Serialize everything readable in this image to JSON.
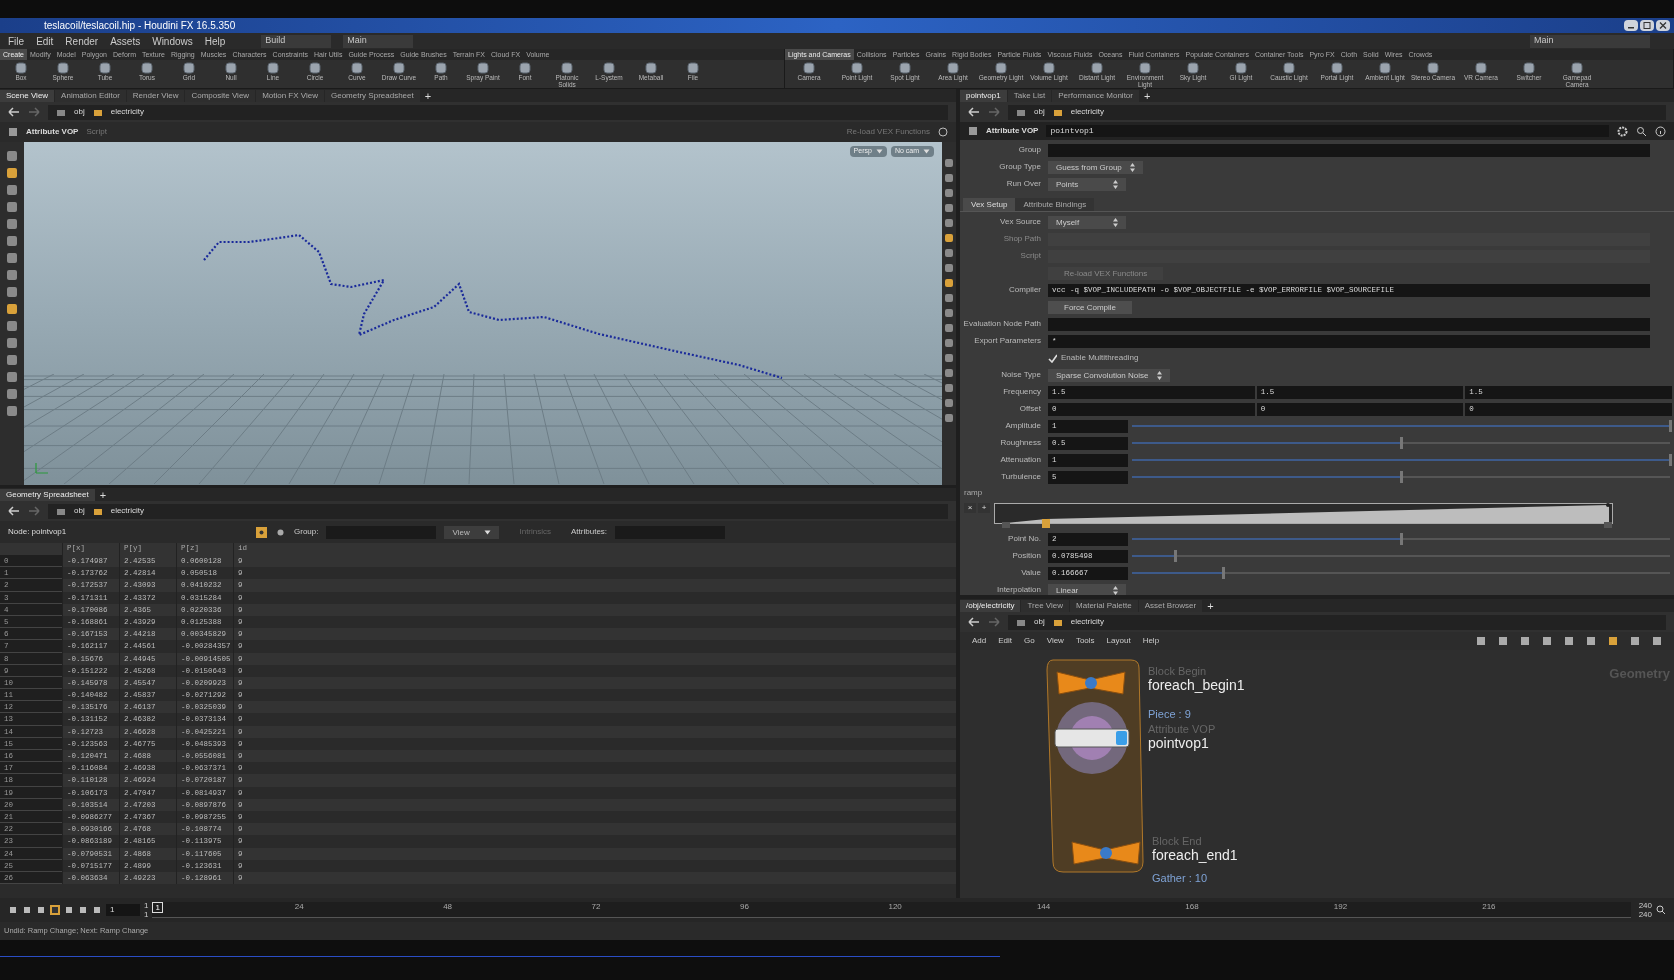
{
  "window": {
    "title": "teslacoil/teslacoil.hip - Houdini FX 16.5.350",
    "menu": [
      "File",
      "Edit",
      "Render",
      "Assets",
      "Windows",
      "Help"
    ],
    "desktop": "Build",
    "main_desktop": "Main",
    "right_desktop": "Main"
  },
  "shelf_left": {
    "tabs": [
      {
        "label": "Create",
        "selected": true
      },
      {
        "label": "Modify",
        "selected": false
      },
      {
        "label": "Model",
        "selected": false
      },
      {
        "label": "Polygon",
        "selected": false
      },
      {
        "label": "Deform",
        "selected": false
      },
      {
        "label": "Texture",
        "selected": false
      },
      {
        "label": "Rigging",
        "selected": false
      },
      {
        "label": "Muscles",
        "selected": false
      },
      {
        "label": "Characters",
        "selected": false
      },
      {
        "label": "Constraints",
        "selected": false
      },
      {
        "label": "Hair Utils",
        "selected": false
      },
      {
        "label": "Guide Process",
        "selected": false
      },
      {
        "label": "Guide Brushes",
        "selected": false
      },
      {
        "label": "Terrain FX",
        "selected": false
      },
      {
        "label": "Cloud FX",
        "selected": false
      },
      {
        "label": "Volume",
        "selected": false
      }
    ],
    "tools": [
      "Box",
      "Sphere",
      "Tube",
      "Torus",
      "Grid",
      "Null",
      "Line",
      "Circle",
      "Curve",
      "Draw Curve",
      "Path",
      "Spray Paint",
      "Font",
      "Platonic Solids",
      "L-System",
      "Metaball",
      "File"
    ]
  },
  "shelf_right": {
    "tabs": [
      {
        "label": "Lights and Cameras",
        "selected": true
      },
      {
        "label": "Collisions",
        "selected": false
      },
      {
        "label": "Particles",
        "selected": false
      },
      {
        "label": "Grains",
        "selected": false
      },
      {
        "label": "Rigid Bodies",
        "selected": false
      },
      {
        "label": "Particle Fluids",
        "selected": false
      },
      {
        "label": "Viscous Fluids",
        "selected": false
      },
      {
        "label": "Oceans",
        "selected": false
      },
      {
        "label": "Fluid Containers",
        "selected": false
      },
      {
        "label": "Populate Containers",
        "selected": false
      },
      {
        "label": "Container Tools",
        "selected": false
      },
      {
        "label": "Pyro FX",
        "selected": false
      },
      {
        "label": "Cloth",
        "selected": false
      },
      {
        "label": "Solid",
        "selected": false
      },
      {
        "label": "Wires",
        "selected": false
      },
      {
        "label": "Crowds",
        "selected": false
      }
    ],
    "tools": [
      "Camera",
      "Point Light",
      "Spot Light",
      "Area Light",
      "Geometry Light",
      "Volume Light",
      "Distant Light",
      "Environment Light",
      "Sky Light",
      "GI Light",
      "Caustic Light",
      "Portal Light",
      "Ambient Light",
      "Stereo Camera",
      "VR Camera",
      "Switcher",
      "Gamepad Camera"
    ]
  },
  "left_pane": {
    "tabs": [
      {
        "label": "Scene View",
        "selected": true
      },
      {
        "label": "Animation Editor",
        "selected": false
      },
      {
        "label": "Render View",
        "selected": false
      },
      {
        "label": "Composite View",
        "selected": false
      },
      {
        "label": "Motion FX View",
        "selected": false
      },
      {
        "label": "Geometry Spreadsheet",
        "selected": false
      }
    ],
    "add_tab": "+",
    "path": [
      "obj",
      "electricity"
    ],
    "viewport": {
      "node_type": "Attribute VOP",
      "script_label": "Script",
      "reload": "Re-load VEX Functions",
      "camera_buttons": [
        "Persp",
        "No cam"
      ]
    }
  },
  "spreadsheet": {
    "tabs": [
      {
        "label": "Geometry Spreadsheet",
        "selected": true
      }
    ],
    "path": [
      "obj",
      "electricity"
    ],
    "node_label": "Node:",
    "node": "pointvop1",
    "group_label": "Group:",
    "view": "View",
    "intrinsics": "Intrinsics",
    "attributes_label": "Attributes:",
    "columns": [
      "P[x]",
      "P[y]",
      "P[z]",
      "id"
    ],
    "add_tab": "+",
    "rows": [
      {
        "index": "0",
        "cells": [
          "-0.174987",
          "2.42535",
          "0.0600128",
          "9"
        ]
      },
      {
        "index": "1",
        "cells": [
          "-0.173762",
          "2.42814",
          "0.050518",
          "9"
        ]
      },
      {
        "index": "2",
        "cells": [
          "-0.172537",
          "2.43093",
          "0.0410232",
          "9"
        ]
      },
      {
        "index": "3",
        "cells": [
          "-0.171311",
          "2.43372",
          "0.0315284",
          "9"
        ]
      },
      {
        "index": "4",
        "cells": [
          "-0.170086",
          "2.4365",
          "0.0220336",
          "9"
        ]
      },
      {
        "index": "5",
        "cells": [
          "-0.168861",
          "2.43929",
          "0.0125388",
          "9"
        ]
      },
      {
        "index": "6",
        "cells": [
          "-0.167153",
          "2.44218",
          "0.00345829",
          "9"
        ]
      },
      {
        "index": "7",
        "cells": [
          "-0.162117",
          "2.44561",
          "-0.00284357",
          "9"
        ]
      },
      {
        "index": "8",
        "cells": [
          "-0.15676",
          "2.44945",
          "-0.00914505",
          "9"
        ]
      },
      {
        "index": "9",
        "cells": [
          "-0.151222",
          "2.45268",
          "-0.0150643",
          "9"
        ]
      },
      {
        "index": "10",
        "cells": [
          "-0.145978",
          "2.45547",
          "-0.0209923",
          "9"
        ]
      },
      {
        "index": "11",
        "cells": [
          "-0.140482",
          "2.45837",
          "-0.0271292",
          "9"
        ]
      },
      {
        "index": "12",
        "cells": [
          "-0.135176",
          "2.46137",
          "-0.0325039",
          "9"
        ]
      },
      {
        "index": "13",
        "cells": [
          "-0.131152",
          "2.46382",
          "-0.0373134",
          "9"
        ]
      },
      {
        "index": "14",
        "cells": [
          "-0.12723",
          "2.46628",
          "-0.0425221",
          "9"
        ]
      },
      {
        "index": "15",
        "cells": [
          "-0.123563",
          "2.46775",
          "-0.0485393",
          "9"
        ]
      },
      {
        "index": "16",
        "cells": [
          "-0.120471",
          "2.4688",
          "-0.0556081",
          "9"
        ]
      },
      {
        "index": "17",
        "cells": [
          "-0.116084",
          "2.46938",
          "-0.0637371",
          "9"
        ]
      },
      {
        "index": "18",
        "cells": [
          "-0.110128",
          "2.46924",
          "-0.0720187",
          "9"
        ]
      },
      {
        "index": "19",
        "cells": [
          "-0.106173",
          "2.47047",
          "-0.0814937",
          "9"
        ]
      },
      {
        "index": "20",
        "cells": [
          "-0.103514",
          "2.47203",
          "-0.0897876",
          "9"
        ]
      },
      {
        "index": "21",
        "cells": [
          "-0.0986277",
          "2.47367",
          "-0.0987255",
          "9"
        ]
      },
      {
        "index": "22",
        "cells": [
          "-0.0930166",
          "2.4768",
          "-0.108774",
          "9"
        ]
      },
      {
        "index": "23",
        "cells": [
          "-0.0863189",
          "2.48165",
          "-0.113975",
          "9"
        ]
      },
      {
        "index": "24",
        "cells": [
          "-0.0790531",
          "2.4868",
          "-0.117605",
          "9"
        ]
      },
      {
        "index": "25",
        "cells": [
          "-0.0715177",
          "2.4899",
          "-0.123631",
          "9"
        ]
      },
      {
        "index": "26",
        "cells": [
          "-0.063634",
          "2.49223",
          "-0.128961",
          "9"
        ]
      }
    ]
  },
  "parameters": {
    "tabs": [
      {
        "label": "pointvop1",
        "selected": true
      },
      {
        "label": "Take List",
        "selected": false
      },
      {
        "label": "Performance Monitor",
        "selected": false
      }
    ],
    "add_tab": "+",
    "path": [
      "obj",
      "electricity"
    ],
    "node_type": "Attribute VOP",
    "node_name": "pointvop1",
    "rows": [
      {
        "kind": "field",
        "label": "Group",
        "disabled": false
      },
      {
        "kind": "menu",
        "label": "Group Type",
        "value": "Guess from Group"
      },
      {
        "kind": "menu",
        "label": "Run Over",
        "value": "Points"
      },
      {
        "kind": "tabs",
        "tabs": [
          {
            "label": "Vex Setup",
            "selected": true
          },
          {
            "label": "Attribute Bindings",
            "selected": false
          }
        ]
      },
      {
        "kind": "menu",
        "label": "Vex Source",
        "value": "Myself"
      },
      {
        "kind": "field",
        "label": "Shop Path",
        "disabled": true
      },
      {
        "kind": "field",
        "label": "Script",
        "disabled": true
      },
      {
        "kind": "button",
        "label": "Re-load VEX Functions",
        "disabled": true
      },
      {
        "kind": "field",
        "label": "Compiler",
        "value": "vcc -q $VOP_INCLUDEPATH -o $VOP_OBJECTFILE -e $VOP_ERRORFILE $VOP_SOURCEFILE",
        "disabled": false
      },
      {
        "kind": "button",
        "label": "Force Compile",
        "disabled": false
      },
      {
        "kind": "field",
        "label": "Evaluation Node Path",
        "disabled": false
      },
      {
        "kind": "field",
        "label": "Export Parameters",
        "value": "*",
        "disabled": false
      },
      {
        "kind": "check",
        "label": "Enable Multithreading",
        "checked": true
      },
      {
        "kind": "menu",
        "label": "Noise Type",
        "value": "Sparse Convolution Noise"
      },
      {
        "kind": "vector",
        "label": "Frequency",
        "values": [
          "1.5",
          "1.5",
          "1.5"
        ]
      },
      {
        "kind": "vector",
        "label": "Offset",
        "values": [
          "0",
          "0",
          "0"
        ]
      },
      {
        "kind": "slider",
        "label": "Amplitude",
        "value": "1",
        "level": 1
      },
      {
        "kind": "slider",
        "label": "Roughness",
        "value": "0.5",
        "level": 0.5
      },
      {
        "kind": "slider",
        "label": "Attenuation",
        "value": "1",
        "level": 1
      },
      {
        "kind": "slider",
        "label": "Turbulence",
        "value": "5",
        "level": 0.5
      },
      {
        "kind": "ramp",
        "label": "ramp",
        "buttons": [
          "×",
          "+"
        ]
      },
      {
        "kind": "slider",
        "label": "Point No.",
        "value": "2",
        "level": 0.5
      },
      {
        "kind": "slider",
        "label": "Position",
        "value": "0.0785498",
        "level": 0.08
      },
      {
        "kind": "slider",
        "label": "Value",
        "value": "0.166667",
        "level": 0.17
      },
      {
        "kind": "menu",
        "label": "Interpolation",
        "value": "Linear"
      }
    ]
  },
  "network": {
    "tabs": [
      {
        "label": "/obj/electricity",
        "selected": true
      },
      {
        "label": "Tree View",
        "selected": false
      },
      {
        "label": "Material Palette",
        "selected": false
      },
      {
        "label": "Asset Browser",
        "selected": false
      }
    ],
    "add_tab": "+",
    "path": [
      "obj",
      "electricity"
    ],
    "menu": [
      "Add",
      "Edit",
      "Go",
      "View",
      "Tools",
      "Layout",
      "Help"
    ],
    "context_label": "Geometry",
    "nodes": [
      {
        "kind": "block_begin",
        "type": "Block Begin",
        "name": "foreach_begin1",
        "info": "Piece : 9"
      },
      {
        "kind": "vop",
        "type": "Attribute VOP",
        "name": "pointvop1"
      },
      {
        "kind": "block_end",
        "type": "Block End",
        "name": "foreach_end1",
        "info": "Gather : 10"
      }
    ]
  },
  "timeline": {
    "frame": "1",
    "range_start": "1",
    "range_end": "1",
    "current": "1",
    "ticks": [
      "24",
      "48",
      "72",
      "96",
      "120",
      "144",
      "168",
      "192",
      "216"
    ],
    "end_frames": [
      "240",
      "240"
    ]
  },
  "status_bar": "Undid: Ramp Change; Next: Ramp Change"
}
